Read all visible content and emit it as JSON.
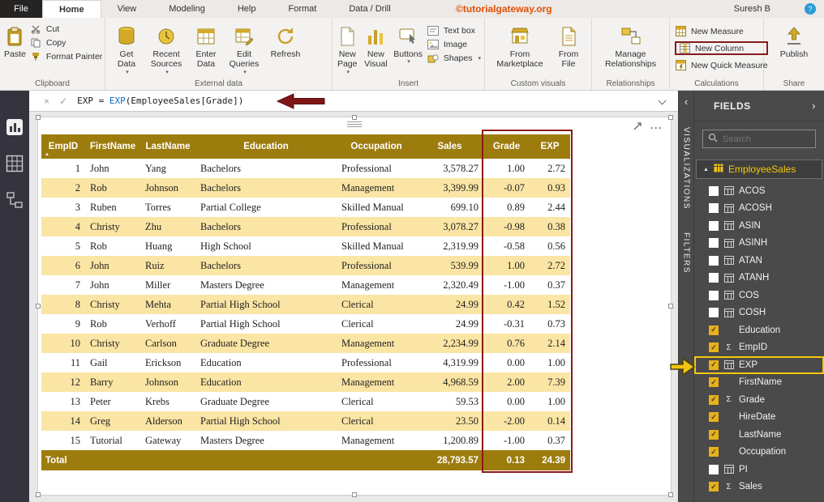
{
  "titlebar": {
    "file_tab": "File",
    "tabs": [
      "Home",
      "View",
      "Modeling",
      "Help",
      "Format",
      "Data / Drill"
    ],
    "brand": "©tutorialgateway.org",
    "user": "Suresh B",
    "help_label": "?"
  },
  "ribbon": {
    "clipboard": {
      "label": "Clipboard",
      "paste": "Paste",
      "cut": "Cut",
      "copy": "Copy",
      "format_painter": "Format Painter"
    },
    "external_data": {
      "label": "External data",
      "get_data": "Get Data",
      "recent_sources": "Recent Sources",
      "enter_data": "Enter Data",
      "edit_queries": "Edit Queries",
      "refresh": "Refresh"
    },
    "insert": {
      "label": "Insert",
      "new_page": "New Page",
      "new_visual": "New Visual",
      "buttons": "Buttons",
      "text_box": "Text box",
      "image": "Image",
      "shapes": "Shapes"
    },
    "custom_visuals": {
      "label": "Custom visuals",
      "from_marketplace": "From Marketplace",
      "from_file": "From File"
    },
    "relationships": {
      "label": "Relationships",
      "manage_relationships": "Manage Relationships"
    },
    "calculations": {
      "label": "Calculations",
      "new_measure": "New Measure",
      "new_column": "New Column",
      "new_quick_measure": "New Quick Measure"
    },
    "share": {
      "label": "Share",
      "publish": "Publish"
    }
  },
  "formula_bar": {
    "lhs": "EXP = ",
    "function": "EXP",
    "args": "(EmployeeSales[Grade])"
  },
  "table_visual": {
    "columns": [
      "EmpID",
      "FirstName",
      "LastName",
      "Education",
      "Occupation",
      "Sales",
      "Grade",
      "EXP"
    ],
    "rows": [
      [
        "1",
        "John",
        "Yang",
        "Bachelors",
        "Professional",
        "3,578.27",
        "1.00",
        "2.72"
      ],
      [
        "2",
        "Rob",
        "Johnson",
        "Bachelors",
        "Management",
        "3,399.99",
        "-0.07",
        "0.93"
      ],
      [
        "3",
        "Ruben",
        "Torres",
        "Partial College",
        "Skilled Manual",
        "699.10",
        "0.89",
        "2.44"
      ],
      [
        "4",
        "Christy",
        "Zhu",
        "Bachelors",
        "Professional",
        "3,078.27",
        "-0.98",
        "0.38"
      ],
      [
        "5",
        "Rob",
        "Huang",
        "High School",
        "Skilled Manual",
        "2,319.99",
        "-0.58",
        "0.56"
      ],
      [
        "6",
        "John",
        "Ruiz",
        "Bachelors",
        "Professional",
        "539.99",
        "1.00",
        "2.72"
      ],
      [
        "7",
        "John",
        "Miller",
        "Masters Degree",
        "Management",
        "2,320.49",
        "-1.00",
        "0.37"
      ],
      [
        "8",
        "Christy",
        "Mehta",
        "Partial High School",
        "Clerical",
        "24.99",
        "0.42",
        "1.52"
      ],
      [
        "9",
        "Rob",
        "Verhoff",
        "Partial High School",
        "Clerical",
        "24.99",
        "-0.31",
        "0.73"
      ],
      [
        "10",
        "Christy",
        "Carlson",
        "Graduate Degree",
        "Management",
        "2,234.99",
        "0.76",
        "2.14"
      ],
      [
        "11",
        "Gail",
        "Erickson",
        "Education",
        "Professional",
        "4,319.99",
        "0.00",
        "1.00"
      ],
      [
        "12",
        "Barry",
        "Johnson",
        "Education",
        "Management",
        "4,968.59",
        "2.00",
        "7.39"
      ],
      [
        "13",
        "Peter",
        "Krebs",
        "Graduate Degree",
        "Clerical",
        "59.53",
        "0.00",
        "1.00"
      ],
      [
        "14",
        "Greg",
        "Alderson",
        "Partial High School",
        "Clerical",
        "23.50",
        "-2.00",
        "0.14"
      ],
      [
        "15",
        "Tutorial",
        "Gateway",
        "Masters Degree",
        "Management",
        "1,200.89",
        "-1.00",
        "0.37"
      ]
    ],
    "total": [
      "Total",
      "",
      "",
      "",
      "",
      "28,793.57",
      "0.13",
      "24.39"
    ]
  },
  "panels": {
    "visualizations": "VISUALIZATIONS",
    "filters": "FILTERS"
  },
  "fields_panel": {
    "title": "FIELDS",
    "search_placeholder": "Search",
    "table_name": "EmployeeSales",
    "items": [
      {
        "label": "ACOS",
        "checked": false,
        "icon": "calc"
      },
      {
        "label": "ACOSH",
        "checked": false,
        "icon": "calc"
      },
      {
        "label": "ASIN",
        "checked": false,
        "icon": "calc"
      },
      {
        "label": "ASINH",
        "checked": false,
        "icon": "calc"
      },
      {
        "label": "ATAN",
        "checked": false,
        "icon": "calc"
      },
      {
        "label": "ATANH",
        "checked": false,
        "icon": "calc"
      },
      {
        "label": "COS",
        "checked": false,
        "icon": "calc"
      },
      {
        "label": "COSH",
        "checked": false,
        "icon": "calc"
      },
      {
        "label": "Education",
        "checked": true,
        "icon": "none"
      },
      {
        "label": "EmpID",
        "checked": true,
        "icon": "sigma"
      },
      {
        "label": "EXP",
        "checked": true,
        "icon": "calc",
        "highlight": true
      },
      {
        "label": "FirstName",
        "checked": true,
        "icon": "none"
      },
      {
        "label": "Grade",
        "checked": true,
        "icon": "sigma"
      },
      {
        "label": "HireDate",
        "checked": true,
        "icon": "none"
      },
      {
        "label": "LastName",
        "checked": true,
        "icon": "none"
      },
      {
        "label": "Occupation",
        "checked": true,
        "icon": "none"
      },
      {
        "label": "PI",
        "checked": false,
        "icon": "calc"
      },
      {
        "label": "Sales",
        "checked": true,
        "icon": "sigma"
      }
    ]
  },
  "colors": {
    "table_header_gold": "#9D7C0E",
    "row_alt_gold": "#FBE5A4",
    "annotation_red": "#8B1A1A",
    "annotation_yellow": "#F2C80F"
  }
}
